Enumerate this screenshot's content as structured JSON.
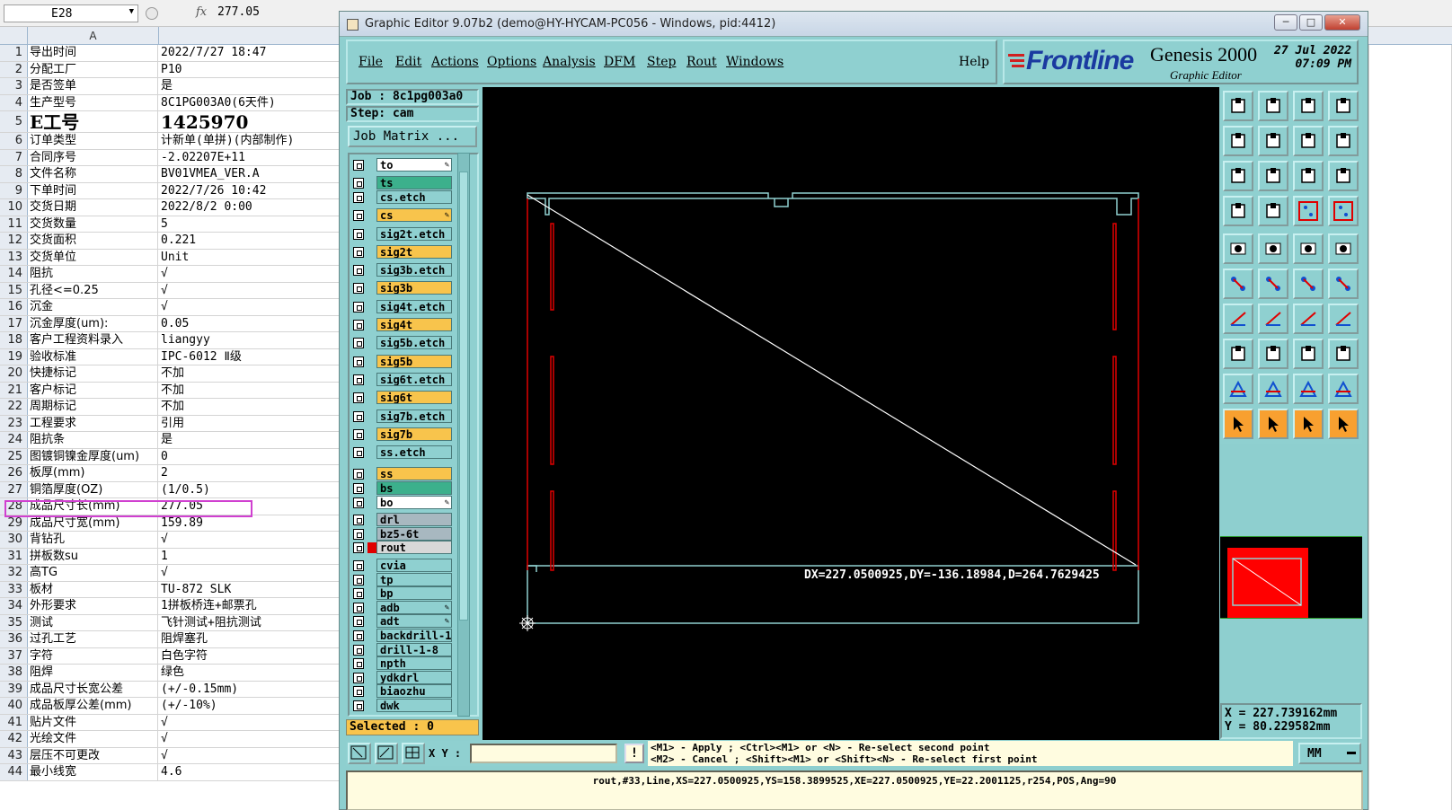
{
  "excel": {
    "name_box": "E28",
    "fx": "fx",
    "formula_value": "277.05",
    "column_a": "A",
    "rows": [
      {
        "n": "1",
        "a": "导出时间",
        "b": "2022/7/27 18:47"
      },
      {
        "n": "2",
        "a": "分配工厂",
        "b": "P10"
      },
      {
        "n": "3",
        "a": "是否签单",
        "b": "是"
      },
      {
        "n": "4",
        "a": "生产型号",
        "b": "8C1PG003A0(6天件)"
      },
      {
        "n": "5",
        "a": "E工号",
        "b": "1425970"
      },
      {
        "n": "6",
        "a": "订单类型",
        "b": "计新单(单拼)(内部制作)"
      },
      {
        "n": "7",
        "a": "合同序号",
        "b": "-2.02207E+11"
      },
      {
        "n": "8",
        "a": "文件名称",
        "b": "BV01VMEA_VER.A"
      },
      {
        "n": "9",
        "a": "下单时间",
        "b": "2022/7/26 10:42"
      },
      {
        "n": "10",
        "a": "交货日期",
        "b": "2022/8/2 0:00"
      },
      {
        "n": "11",
        "a": "交货数量",
        "b": "5"
      },
      {
        "n": "12",
        "a": "交货面积",
        "b": "0.221"
      },
      {
        "n": "13",
        "a": "交货单位",
        "b": "Unit"
      },
      {
        "n": "14",
        "a": "阻抗",
        "b": "√"
      },
      {
        "n": "15",
        "a": "孔径<=0.25",
        "b": "√"
      },
      {
        "n": "16",
        "a": "沉金",
        "b": "√"
      },
      {
        "n": "17",
        "a": "沉金厚度(um):",
        "b": "0.05"
      },
      {
        "n": "18",
        "a": "客户工程资料录入",
        "b": "liangyy"
      },
      {
        "n": "19",
        "a": "验收标准",
        "b": "IPC-6012 Ⅱ级"
      },
      {
        "n": "20",
        "a": "快捷标记",
        "b": "不加"
      },
      {
        "n": "21",
        "a": "客户标记",
        "b": "不加"
      },
      {
        "n": "22",
        "a": "周期标记",
        "b": "不加"
      },
      {
        "n": "23",
        "a": "工程要求",
        "b": "引用"
      },
      {
        "n": "24",
        "a": "阻抗条",
        "b": "是"
      },
      {
        "n": "25",
        "a": "图镀铜镍金厚度(um)",
        "b": "0"
      },
      {
        "n": "26",
        "a": "板厚(mm)",
        "b": "2"
      },
      {
        "n": "27",
        "a": "铜箔厚度(OZ)",
        "b": " (1/0.5)"
      },
      {
        "n": "28",
        "a": "成品尺寸长(mm)",
        "b": "277.05"
      },
      {
        "n": "29",
        "a": "成品尺寸宽(mm)",
        "b": "159.89"
      },
      {
        "n": "30",
        "a": "背钻孔",
        "b": "√"
      },
      {
        "n": "31",
        "a": "拼板数su",
        "b": "1"
      },
      {
        "n": "32",
        "a": "高TG",
        "b": "√"
      },
      {
        "n": "33",
        "a": "板材",
        "b": "TU-872 SLK"
      },
      {
        "n": "34",
        "a": "外形要求",
        "b": "1拼板桥连+邮票孔"
      },
      {
        "n": "35",
        "a": "测试",
        "b": "飞针测试+阻抗测试"
      },
      {
        "n": "36",
        "a": "过孔工艺",
        "b": "阻焊塞孔"
      },
      {
        "n": "37",
        "a": "字符",
        "b": "白色字符"
      },
      {
        "n": "38",
        "a": "阻焊",
        "b": "绿色"
      },
      {
        "n": "39",
        "a": "成品尺寸长宽公差",
        "b": "(+/-0.15mm)"
      },
      {
        "n": "40",
        "a": "成品板厚公差(mm)",
        "b": "(+/-10%)"
      },
      {
        "n": "41",
        "a": "贴片文件",
        "b": "√"
      },
      {
        "n": "42",
        "a": "光绘文件",
        "b": "√"
      },
      {
        "n": "43",
        "a": "层压不可更改",
        "b": "√"
      },
      {
        "n": "44",
        "a": "最小线宽",
        "b": "4.6"
      }
    ]
  },
  "genesis": {
    "title": "Graphic Editor 9.07b2 (demo@HY-HYCAM-PC056 - Windows, pid:4412)",
    "menus": [
      "File",
      "Edit",
      "Actions",
      "Options",
      "Analysis",
      "DFM",
      "Step",
      "Rout",
      "Windows"
    ],
    "help": "Help",
    "logo": {
      "brand": "Frontline",
      "product": "Genesis 2000",
      "subtitle": "Graphic Editor",
      "date": "27 Jul 2022",
      "time": "07:09 PM"
    },
    "job": "Job  : 8c1pg003a0",
    "step": "Step: cam",
    "job_matrix": "Job Matrix ...",
    "layers": [
      {
        "name": "to",
        "color": "#ffffff",
        "pen": true
      },
      {
        "name": "ts",
        "color": "#3cb08c",
        "pen": false
      },
      {
        "name": "cs.etch",
        "color": "#8fd0d0",
        "pen": false
      },
      {
        "name": "cs",
        "color": "#f8c44c",
        "pen": true
      },
      {
        "name": "sig2t.etch",
        "color": "#8fd0d0",
        "pen": false
      },
      {
        "name": "sig2t",
        "color": "#f8c44c",
        "pen": false
      },
      {
        "name": "sig3b.etch",
        "color": "#8fd0d0",
        "pen": false
      },
      {
        "name": "sig3b",
        "color": "#f8c44c",
        "pen": false
      },
      {
        "name": "sig4t.etch",
        "color": "#8fd0d0",
        "pen": false
      },
      {
        "name": "sig4t",
        "color": "#f8c44c",
        "pen": false
      },
      {
        "name": "sig5b.etch",
        "color": "#8fd0d0",
        "pen": false
      },
      {
        "name": "sig5b",
        "color": "#f8c44c",
        "pen": false
      },
      {
        "name": "sig6t.etch",
        "color": "#8fd0d0",
        "pen": false
      },
      {
        "name": "sig6t",
        "color": "#f8c44c",
        "pen": false
      },
      {
        "name": "sig7b.etch",
        "color": "#8fd0d0",
        "pen": false
      },
      {
        "name": "sig7b",
        "color": "#f8c44c",
        "pen": false
      },
      {
        "name": "ss.etch",
        "color": "#8fd0d0",
        "pen": false
      },
      {
        "name": "ss",
        "color": "#f8c44c",
        "pen": false
      },
      {
        "name": "bs",
        "color": "#3cb08c",
        "pen": false
      },
      {
        "name": "bo",
        "color": "#ffffff",
        "pen": true
      },
      {
        "name": "drl",
        "color": "#a8b8c0",
        "pen": false
      },
      {
        "name": "bz5-6t",
        "color": "#a8b8c0",
        "pen": false
      },
      {
        "name": "rout",
        "color": "#d8d8d8",
        "pen": false
      },
      {
        "name": "cvia",
        "color": "#8fd0d0",
        "pen": false
      },
      {
        "name": "tp",
        "color": "#8fd0d0",
        "pen": false
      },
      {
        "name": "bp",
        "color": "#8fd0d0",
        "pen": false
      },
      {
        "name": "adb",
        "color": "#8fd0d0",
        "pen": true
      },
      {
        "name": "adt",
        "color": "#8fd0d0",
        "pen": true
      },
      {
        "name": "backdrill-1-",
        "color": "#8fd0d0",
        "pen": false
      },
      {
        "name": "drill-1-8",
        "color": "#8fd0d0",
        "pen": false
      },
      {
        "name": "npth",
        "color": "#8fd0d0",
        "pen": false
      },
      {
        "name": "ydkdrl",
        "color": "#8fd0d0",
        "pen": false
      },
      {
        "name": "biaozhu",
        "color": "#8fd0d0",
        "pen": false
      },
      {
        "name": "dwk",
        "color": "#8fd0d0",
        "pen": false
      }
    ],
    "selected": "Selected : 0",
    "measure": "DX=227.0500925,DY=-136.18984,D=264.7629425",
    "coords": {
      "x": "X  =  227.739162mm",
      "y": "Y  =  80.229582mm"
    },
    "xy_label": "X Y :",
    "excl": "!",
    "mouse_help_1": "<M1> - Apply  ; <Ctrl><M1> or <N> - Re-select second point",
    "mouse_help_2": "<M2> - Cancel ; <Shift><M1> or <Shift><N> - Re-select first point",
    "units": "MM",
    "status": "rout,#33,Line,XS=227.0500925,YS=158.3899525,XE=227.0500925,YE=22.2001125,r254,POS,Ang=90",
    "colors": {
      "bg": "#8fd0d0",
      "canvas": "#000000",
      "outline": "#8fd0d0",
      "rout": "#e00000",
      "measure_line": "#ffffff"
    }
  }
}
